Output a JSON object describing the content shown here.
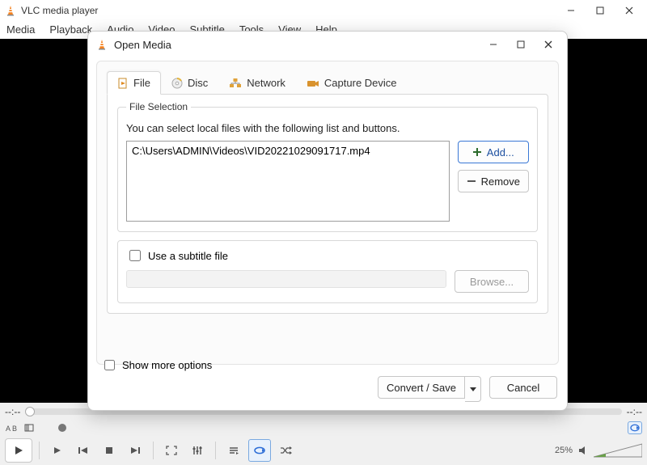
{
  "app": {
    "title": "VLC media player"
  },
  "menu": {
    "media": "Media",
    "playback": "Playback",
    "audio": "Audio",
    "video": "Video",
    "subtitle": "Subtitle",
    "tools": "Tools",
    "view": "View",
    "help": "Help"
  },
  "time": {
    "current": "--:--",
    "total": "--:--"
  },
  "volume": {
    "percent": "25%"
  },
  "dialog": {
    "title": "Open Media",
    "tabs": {
      "file": "File",
      "disc": "Disc",
      "network": "Network",
      "capture": "Capture Device"
    },
    "file_selection": {
      "legend": "File Selection",
      "hint": "You can select local files with the following list and buttons.",
      "files": [
        "C:\\Users\\ADMIN\\Videos\\VID20221029091717.mp4"
      ],
      "add_label": "Add...",
      "remove_label": "Remove"
    },
    "subtitle": {
      "use_label": "Use a subtitle file",
      "browse_label": "Browse..."
    },
    "show_more": "Show more options",
    "convert_label": "Convert / Save",
    "cancel_label": "Cancel"
  }
}
